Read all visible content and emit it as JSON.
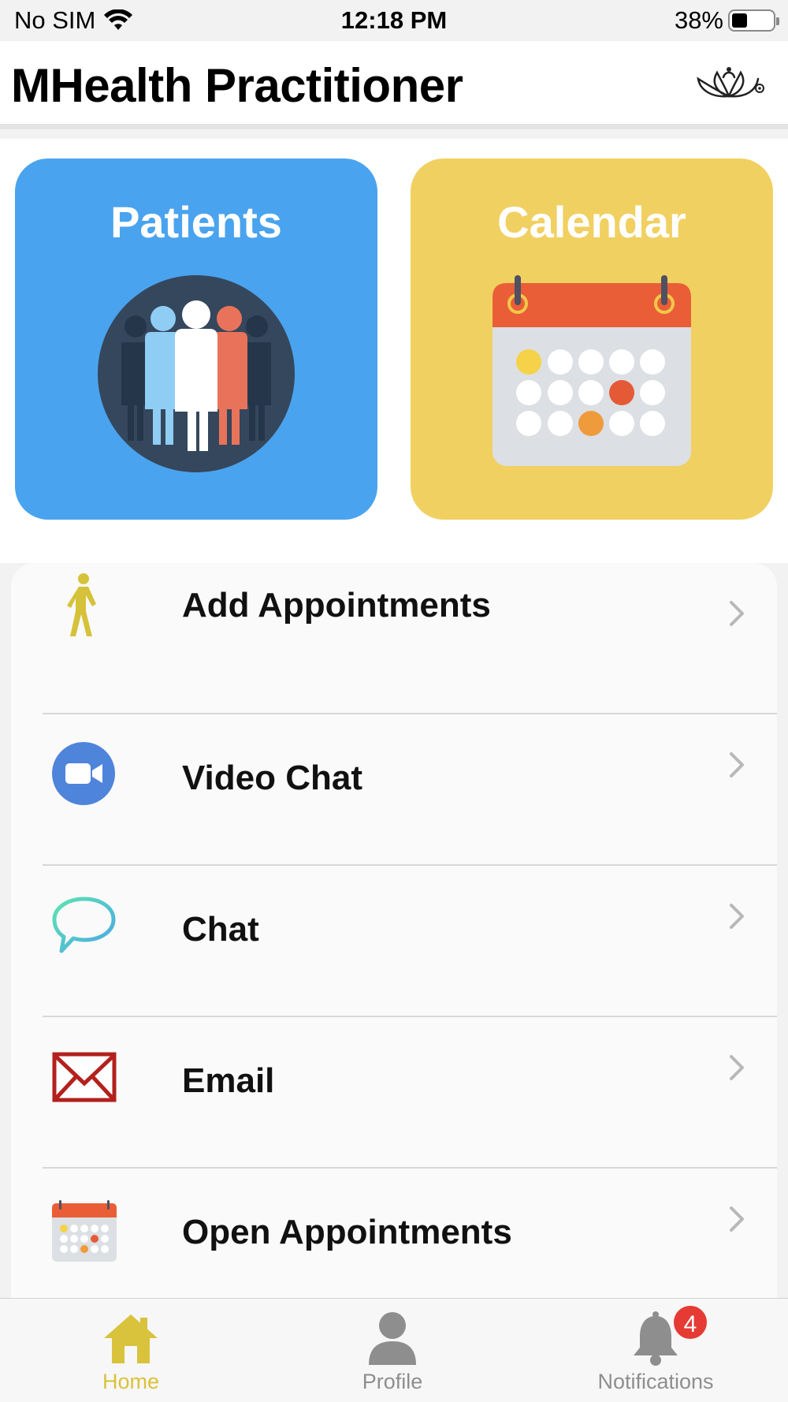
{
  "status_bar": {
    "carrier": "No SIM",
    "time": "12:18 PM",
    "battery": "38%"
  },
  "header": {
    "title": "MHealth Practitioner"
  },
  "tiles": {
    "patients": {
      "label": "Patients",
      "color": "#4aa3ee",
      "icon": "patients-group-icon"
    },
    "calendar": {
      "label": "Calendar",
      "color": "#f1d062",
      "icon": "calendar-icon"
    }
  },
  "menu": {
    "items": [
      {
        "label": "Add Appointments",
        "icon": "walking-person-icon"
      },
      {
        "label": "Video Chat",
        "icon": "video-camera-icon"
      },
      {
        "label": "Chat",
        "icon": "chat-bubble-icon"
      },
      {
        "label": "Email",
        "icon": "envelope-icon"
      },
      {
        "label": "Open Appointments",
        "icon": "calendar-icon"
      }
    ]
  },
  "tabbar": {
    "tabs": [
      {
        "label": "Home",
        "icon": "home-icon",
        "active": true
      },
      {
        "label": "Profile",
        "icon": "person-icon",
        "active": false
      },
      {
        "label": "Notifications",
        "icon": "bell-icon",
        "active": false,
        "badge": "4"
      }
    ],
    "active_color": "#d9c23c"
  }
}
